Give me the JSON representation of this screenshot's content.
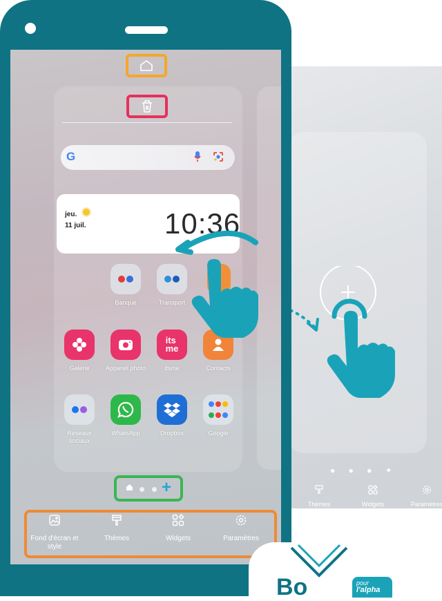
{
  "phone": {
    "clock": {
      "day": "jeu.",
      "date": "11 juil.",
      "time": "10:36"
    },
    "search": {
      "logo": "G"
    },
    "apps": [
      {
        "label": "Banque",
        "icon": "banque-folder-icon"
      },
      {
        "label": "Transport",
        "icon": "transport-folder-icon"
      },
      {
        "label": "Galerie",
        "icon": "galerie-icon",
        "color": "#e8336b"
      },
      {
        "label": "Appareil photo",
        "icon": "camera-icon",
        "color": "#e8336b"
      },
      {
        "label": "itsme",
        "icon": "itsme-icon",
        "color": "#e8336b",
        "text": "its\nme"
      },
      {
        "label": "Contacts",
        "icon": "contacts-icon",
        "color": "#f0843a"
      },
      {
        "label": "Réseaux\nsociaux",
        "icon": "reseaux-folder-icon"
      },
      {
        "label": "WhatsApp",
        "icon": "whatsapp-icon",
        "color": "#2fb84a"
      },
      {
        "label": "Dropbox",
        "icon": "dropbox-icon",
        "color": "#1f6ed6"
      },
      {
        "label": "Google",
        "icon": "google-folder-icon"
      }
    ],
    "menu": [
      {
        "label": "Fond d'écran et\nstyle",
        "icon": "wallpaper-icon"
      },
      {
        "label": "Thèmes",
        "icon": "brush-icon"
      },
      {
        "label": "Widgets",
        "icon": "widgets-icon"
      },
      {
        "label": "Paramètres",
        "icon": "settings-icon"
      }
    ],
    "highlight_colors": {
      "home": "#f3a72c",
      "trash": "#e5305c",
      "indicator": "#3bb554",
      "menu": "#ef8a33"
    }
  },
  "ghost_panel": {
    "menu": [
      {
        "label": "Thèmes",
        "icon": "brush-icon"
      },
      {
        "label": "Widgets",
        "icon": "widgets-icon"
      },
      {
        "label": "Paramètres",
        "icon": "settings-icon"
      }
    ]
  },
  "colors": {
    "phone_frame": "#0f7384",
    "hand": "#1aa3b8",
    "accent_plus": "#22a7d6"
  },
  "logo": {
    "text": "Bo",
    "tag1": "pour",
    "tag2": "l'alpha"
  }
}
